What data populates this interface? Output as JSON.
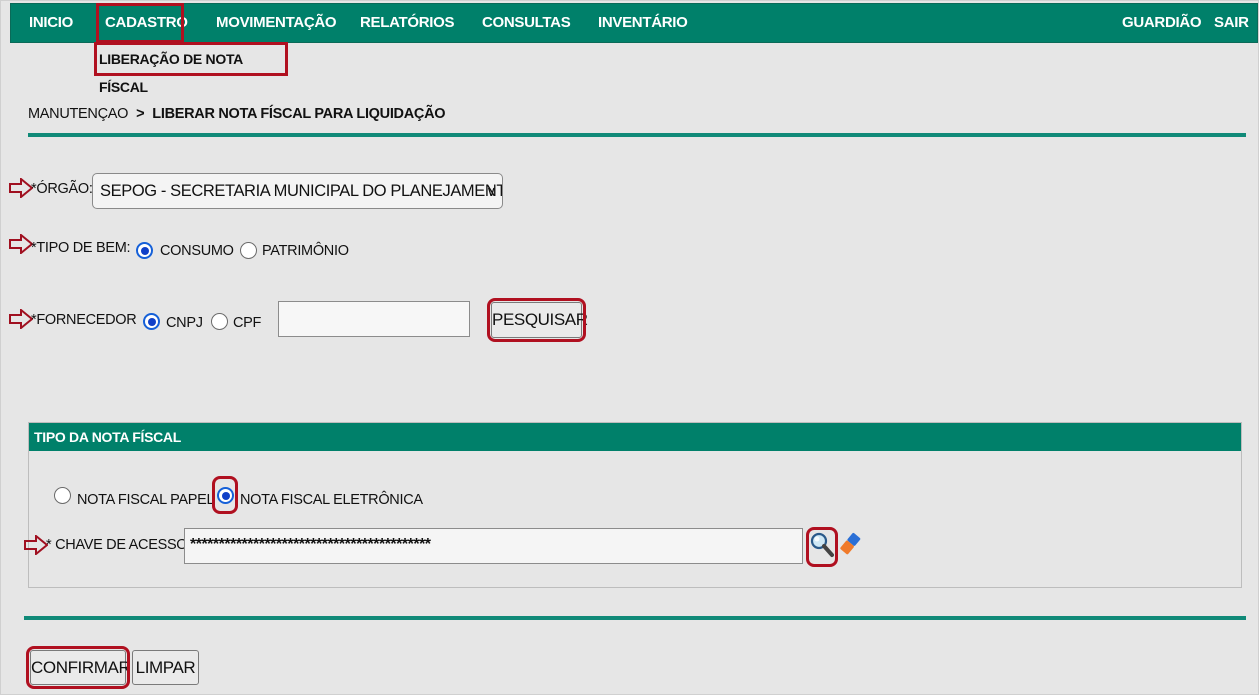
{
  "nav": {
    "items": [
      "INICIO",
      "CADASTRO",
      "MOVIMENTAÇÃO",
      "RELATÓRIOS",
      "CONSULTAS",
      "INVENTÁRIO"
    ],
    "right_items": [
      "GUARDIÃO",
      "SAIR"
    ],
    "submenu_item": "LIBERAÇÃO DE NOTA FÍSCAL"
  },
  "breadcrumb": {
    "parent": "MANUTENÇAO",
    "separator": ">",
    "current": "LIBERAR NOTA FÍSCAL PARA LIQUIDAÇÃO"
  },
  "form": {
    "orgao": {
      "label": "*ÓRGÃO:",
      "selected": "SEPOG - SECRETARIA MUNICIPAL DO PLANEJAMENTO, ORÇAMENTO E GESTÃO"
    },
    "tipo_bem": {
      "label": "*TIPO DE BEM:",
      "options": [
        "CONSUMO",
        "PATRIMÔNIO"
      ],
      "selected": "CONSUMO"
    },
    "fornecedor": {
      "label": "*FORNECEDOR",
      "options": [
        "CNPJ",
        "CPF"
      ],
      "selected": "CNPJ",
      "value": "",
      "search_button": "PESQUISAR"
    }
  },
  "nota_panel": {
    "title": "TIPO DA NOTA FÍSCAL",
    "options": [
      "NOTA FISCAL PAPEL",
      "NOTA FISCAL ELETRÔNICA"
    ],
    "selected": "NOTA FISCAL ELETRÔNICA",
    "chave_label": "* CHAVE DE ACESSO:",
    "chave_value": "******************************************",
    "icons": [
      "magnifier-icon",
      "eraser-icon"
    ]
  },
  "actions": {
    "confirm": "CONFIRMAR",
    "clear": "LIMPAR"
  },
  "colors": {
    "accent": "#00806a",
    "highlight": "#b01020"
  }
}
